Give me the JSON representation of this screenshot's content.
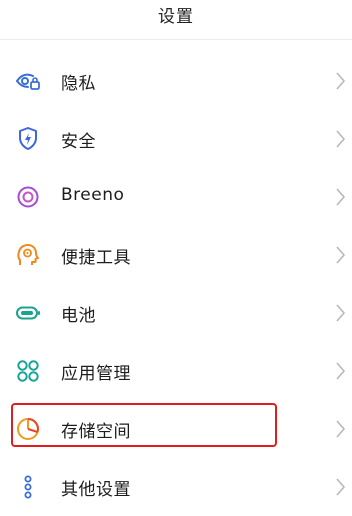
{
  "header": {
    "title": "设置"
  },
  "items": [
    {
      "label": "隐私",
      "icon": "privacy-eye-lock-icon"
    },
    {
      "label": "安全",
      "icon": "security-shield-bolt-icon"
    },
    {
      "label": "Breeno",
      "icon": "breeno-ring-icon"
    },
    {
      "label": "便捷工具",
      "icon": "convenience-tools-icon"
    },
    {
      "label": "电池",
      "icon": "battery-icon"
    },
    {
      "label": "应用管理",
      "icon": "app-management-icon"
    },
    {
      "label": "存储空间",
      "icon": "storage-pie-icon"
    },
    {
      "label": "其他设置",
      "icon": "other-settings-dots-icon"
    }
  ],
  "colors": {
    "privacy": "#3b6fd8",
    "security": "#3e66e0",
    "breeno": "#a64bd6",
    "tools": "#f08a1c",
    "battery": "#1aa38d",
    "apps": "#17a398",
    "storage": "#f09a1c",
    "other": "#3b6fd8",
    "highlight_border": "#e11d1d",
    "chevron": "#b9b9b9"
  }
}
